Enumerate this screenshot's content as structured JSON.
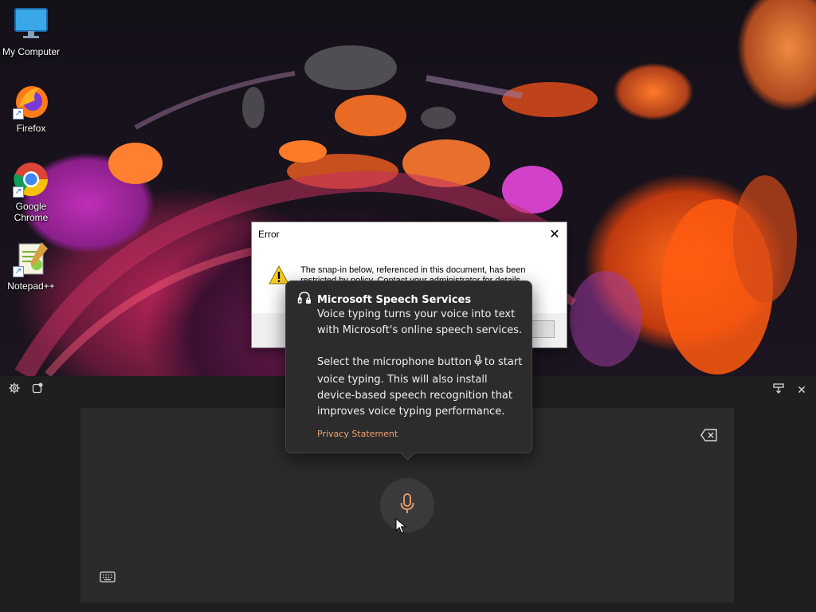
{
  "desktop": {
    "icons": [
      {
        "label": "My Computer",
        "icon": "monitor-icon"
      },
      {
        "label": "Firefox",
        "icon": "firefox-icon"
      },
      {
        "label": "Google Chrome",
        "icon": "chrome-icon"
      },
      {
        "label": "Notepad++",
        "icon": "notepadpp-icon"
      }
    ]
  },
  "error_dialog": {
    "title": "Error",
    "close_symbol": "✕",
    "message": "The snap-in below, referenced in this document, has been restricted by policy. Contact your administrator for details.",
    "icon": "warning-icon"
  },
  "speech_flyout": {
    "title": "Microsoft Speech Services",
    "description": "Voice typing turns your voice into text with Microsoft's online speech services.",
    "instruction_before": "Select the microphone button",
    "instruction_after": "to start voice typing. This will also install device-based speech recognition that improves voice typing performance.",
    "privacy_link": "Privacy Statement"
  },
  "voice_panel": {
    "settings_icon": "gear-icon",
    "help_icon": "help-icon",
    "dock_icon": "dock-icon",
    "close_symbol": "✕",
    "mic_icon": "microphone-icon",
    "backspace_icon": "backspace-icon",
    "keyboard_icon": "keyboard-icon"
  },
  "colors": {
    "accent": "#f0a070",
    "panel_bg": "#1f1f1f",
    "voice_area_bg": "#2b2b2b",
    "flyout_bg": "#2c2c2c"
  }
}
